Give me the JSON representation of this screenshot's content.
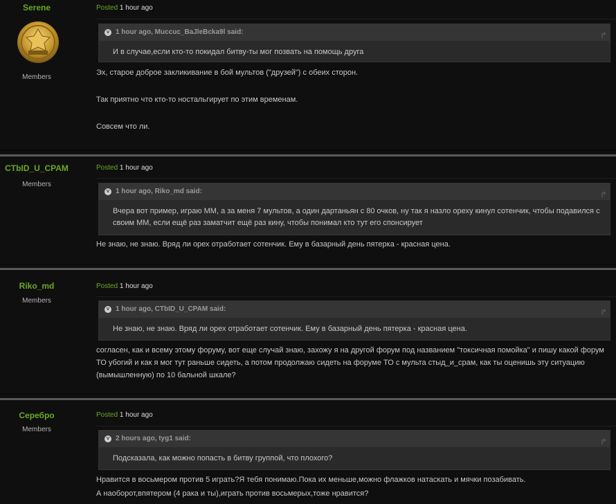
{
  "posts": [
    {
      "author": "Serene",
      "group": "Members",
      "posted_label": "Posted",
      "time": "1 hour ago",
      "quote_header": "1 hour ago, Muccuc_BaJleBcka9l said:",
      "quote_text": "И в случае,если кто-то покидал битву-ты мог позвать на помощь друга",
      "paragraphs": [
        "Эх, старое доброе закликивание в бой мультов (\"друзей\") с обеих сторон.",
        "Так приятно что кто-то ностальгирует по этим временам.",
        "Совсем что ли."
      ],
      "avatar_color": "#c99a2e"
    },
    {
      "author": "CTbID_U_CPAM",
      "group": "Members",
      "posted_label": "Posted",
      "time": "1 hour ago",
      "quote_header": "1 hour ago, Riko_md said:",
      "quote_text": "Вчера вот пример, играю ММ, а за меня 7 мультов, а один дартаньян с 80 очков, ну так я назло ореху кинул сотенчик, чтобы подавился с своим ММ, если ещё раз заматчит ещё раз кину, чтобы понимал кто тут его спонсирует",
      "paragraphs": [
        "Не знаю, не знаю. Вряд ли орех отработает сотенчик. Ему в базарный день пятерка - красная цена."
      ]
    },
    {
      "author": "Riko_md",
      "group": "Members",
      "posted_label": "Posted",
      "time": "1 hour ago",
      "quote_header": "1 hour ago, CTbID_U_CPAM said:",
      "quote_text": "Не знаю, не знаю. Вряд ли орех отработает сотенчик. Ему в базарный день пятерка - красная цена.",
      "paragraphs": [
        "согласен, как и всему этому форуму, вот еще случай знаю, захожу я на другой форум под названием \"токсичная помойка\" и пишу какой форум ТО убогий и как я мог тут раньше сидеть, а потом продолжаю сидеть на форуме ТО с мульта стыд_и_срам, как ты оценишь эту ситуацию (вымышленную) по 10 бальной шкале?"
      ]
    },
    {
      "author": "Серебро",
      "group": "Members",
      "posted_label": "Posted",
      "time": "1 hour ago",
      "quote_header": "2 hours ago, tyg1 said:",
      "quote_text": "Подсказала, как  можно попасть в битву  группой, что плохого?",
      "paragraphs": [
        "Нравится в восьмером против 5 играть?Я тебя понимаю.Пока их меньше,можно флажков натаскать и мячки позабивать.",
        "А наоборот,впятером (4 рака и ты),играть против восьмерых,тоже нравится?"
      ]
    }
  ],
  "colors": {
    "background": "#0f0f0f",
    "author": "#6aa826",
    "quote_bg": "#2a2a2a",
    "quote_header_bg": "#353535",
    "divider": "#5a5a5a"
  }
}
